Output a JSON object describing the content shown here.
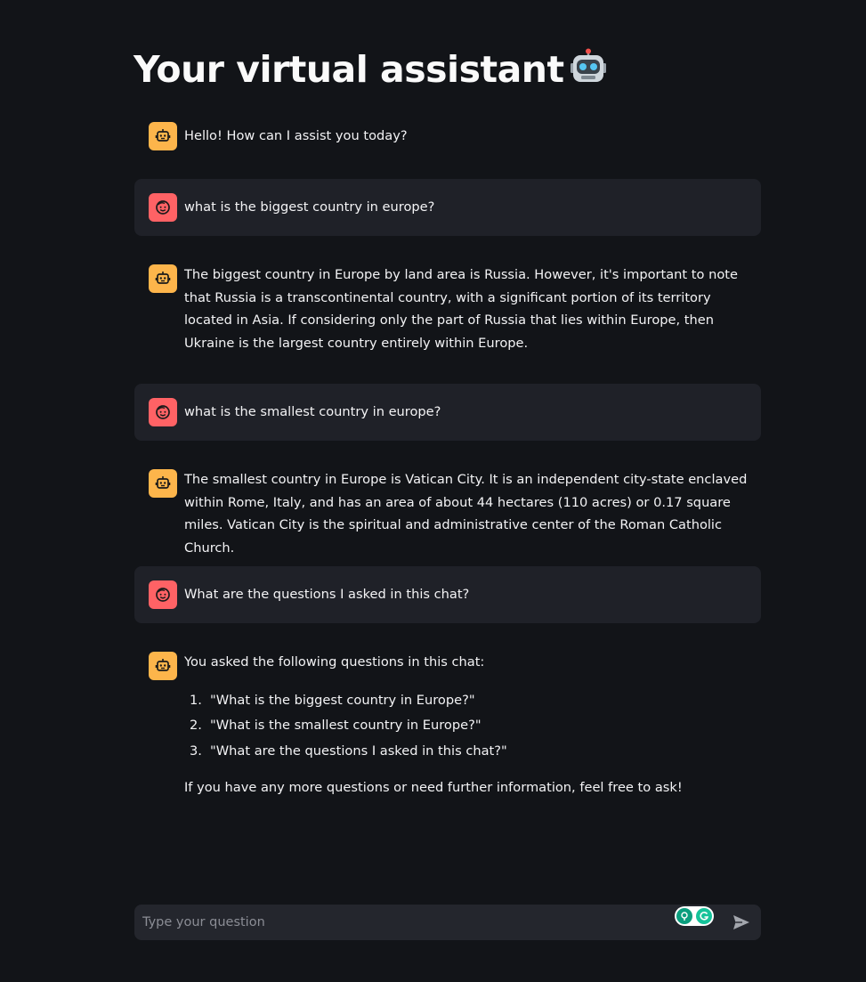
{
  "header": {
    "title": "Your virtual assistant"
  },
  "chat": {
    "messages": [
      {
        "role": "assistant",
        "text": "Hello! How can I assist you today?"
      },
      {
        "role": "user",
        "text": "what is the biggest country in europe?"
      },
      {
        "role": "assistant",
        "text": "The biggest country in Europe by land area is Russia. However, it's important to note that Russia is a transcontinental country, with a significant portion of its territory located in Asia. If considering only the part of Russia that lies within Europe, then Ukraine is the largest country entirely within Europe."
      },
      {
        "role": "user",
        "text": "what is the smallest country in europe?"
      },
      {
        "role": "assistant",
        "text": "The smallest country in Europe is Vatican City. It is an independent city-state enclaved within Rome, Italy, and has an area of about 44 hectares (110 acres) or 0.17 square miles. Vatican City is the spiritual and administrative center of the Roman Catholic Church."
      },
      {
        "role": "user",
        "text": "What are the questions I asked in this chat?"
      },
      {
        "role": "assistant",
        "intro": "You asked the following questions in this chat:",
        "list": [
          {
            "num": "1.",
            "text": "\"What is the biggest country in Europe?\""
          },
          {
            "num": "2.",
            "text": "\"What is the smallest country in Europe?\""
          },
          {
            "num": "3.",
            "text": "\"What are the questions I asked in this chat?\""
          }
        ],
        "closing": "If you have any more questions or need further information, feel free to ask!"
      }
    ]
  },
  "input": {
    "placeholder": "Type your question"
  },
  "icons": {
    "assistant_avatar": "robot-face-icon",
    "user_avatar": "smiley-face-icon",
    "send": "send-arrow-icon",
    "extension_badge": "grammarly-extension-icon"
  },
  "colors": {
    "background": "#121418",
    "user_message_bg": "#1f2128",
    "assistant_avatar_bg": "#fdb54b",
    "user_avatar_bg": "#ff6265",
    "input_bg": "#24262d"
  }
}
